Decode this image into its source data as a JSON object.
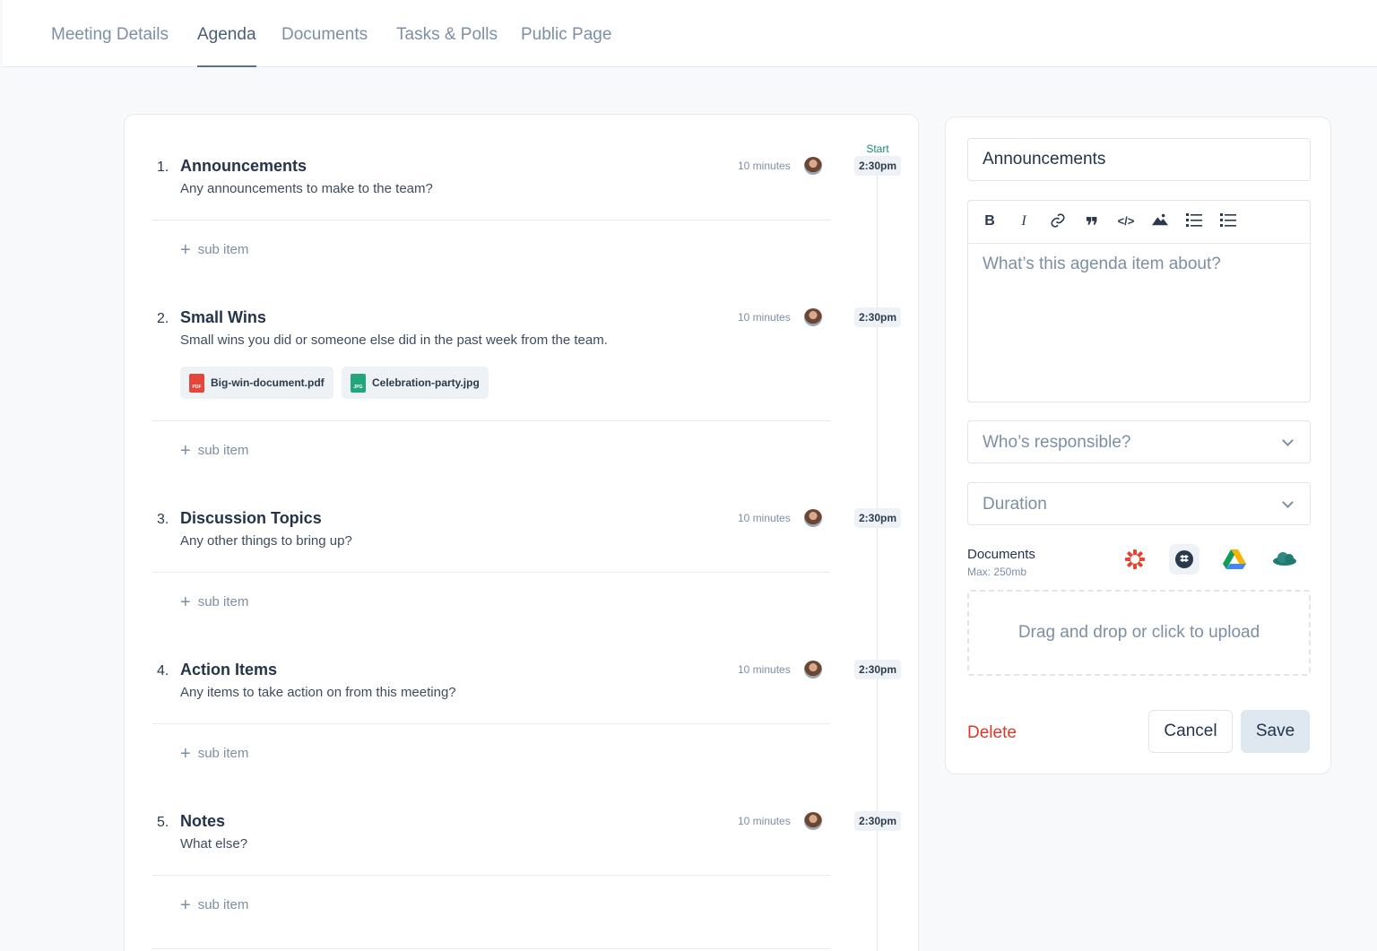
{
  "tabs": [
    {
      "label": "Meeting Details"
    },
    {
      "label": "Agenda"
    },
    {
      "label": "Documents"
    },
    {
      "label": "Tasks & Polls"
    },
    {
      "label": "Public Page"
    }
  ],
  "agenda": {
    "start_label": "Start",
    "sub_item_label": "sub item",
    "items": [
      {
        "num": "1.",
        "title": "Announcements",
        "desc": "Any announcements to make to the team?",
        "minutes": "10 minutes",
        "time": "2:30pm"
      },
      {
        "num": "2.",
        "title": "Small Wins",
        "desc": "Small wins you did or someone else did in the past week from the team.",
        "minutes": "10 minutes",
        "time": "2:30pm",
        "files": [
          {
            "name": "Big-win-document.pdf",
            "type": "PDF"
          },
          {
            "name": "Celebration-party.jpg",
            "type": "JPG"
          }
        ]
      },
      {
        "num": "3.",
        "title": "Discussion Topics",
        "desc": "Any other things to bring up?",
        "minutes": "10 minutes",
        "time": "2:30pm"
      },
      {
        "num": "4.",
        "title": "Action Items",
        "desc": "Any items to take action on from this meeting?",
        "minutes": "10 minutes",
        "time": "2:30pm"
      },
      {
        "num": "5.",
        "title": "Notes",
        "desc": "What else?",
        "minutes": "10 minutes",
        "time": "2:30pm"
      }
    ]
  },
  "editor": {
    "title_value": "Announcements",
    "body_placeholder": "What’s this agenda item about?",
    "toolbar": [
      "B",
      "I",
      "link",
      "quote",
      "code",
      "image",
      "bullet-list",
      "numbered-list"
    ],
    "responsible_placeholder": "Who’s responsible?",
    "duration_placeholder": "Duration",
    "documents_label": "Documents",
    "documents_max": "Max: 250mb",
    "dropzone_text": "Drag and drop or click to upload",
    "delete_label": "Delete",
    "cancel_label": "Cancel",
    "save_label": "Save"
  }
}
